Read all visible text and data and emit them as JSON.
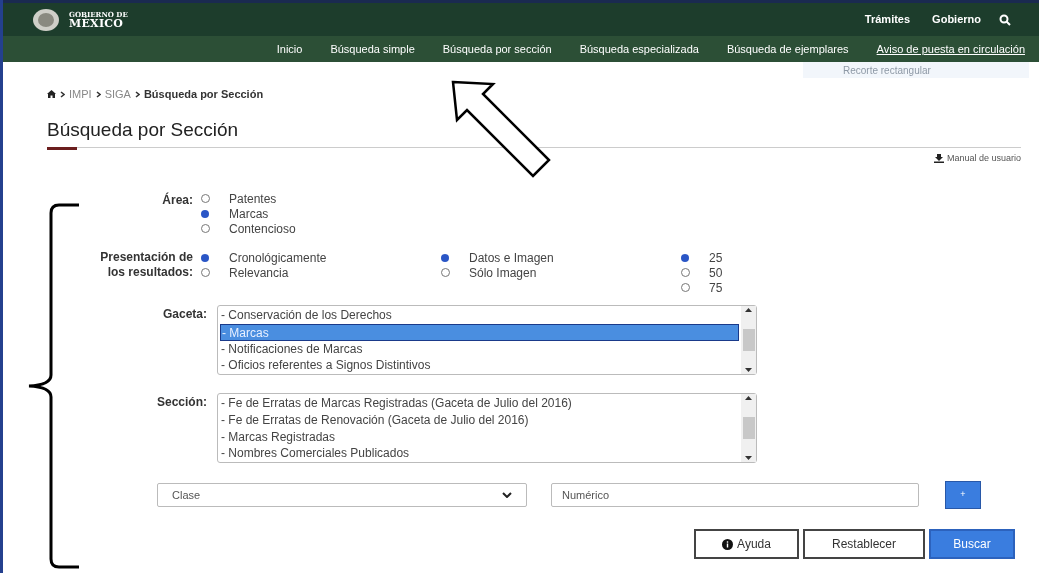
{
  "header": {
    "logo_lines": [
      "GOBIERNO DE",
      "MÉXICO"
    ],
    "links": [
      "Trámites",
      "Gobierno"
    ]
  },
  "nav": [
    {
      "label": "Inicio",
      "selected": false
    },
    {
      "label": "Búsqueda simple",
      "selected": false
    },
    {
      "label": "Búsqueda por sección",
      "selected": false
    },
    {
      "label": "Búsqueda especializada",
      "selected": false
    },
    {
      "label": "Búsqueda de ejemplares",
      "selected": false
    },
    {
      "label": "Aviso de puesta en circulación",
      "selected": true
    }
  ],
  "snip_tooltip": "Recorte rectangular",
  "breadcrumb": [
    "IMPI",
    "SIGA",
    "Búsqueda por Sección"
  ],
  "title": "Búsqueda por Sección",
  "manual_link": "Manual de usuario",
  "area": {
    "label": "Área:",
    "options": [
      {
        "label": "Patentes",
        "selected": false
      },
      {
        "label": "Marcas",
        "selected": true
      },
      {
        "label": "Contencioso",
        "selected": false
      }
    ]
  },
  "presentation": {
    "label": "Presentación de los resultados:",
    "groups": [
      [
        {
          "label": "Cronológicamente",
          "selected": true
        },
        {
          "label": "Relevancia",
          "selected": false
        }
      ],
      [
        {
          "label": "Datos e Imagen",
          "selected": true
        },
        {
          "label": "Sólo Imagen",
          "selected": false
        }
      ],
      [
        {
          "label": "25",
          "selected": true
        },
        {
          "label": "50",
          "selected": false
        },
        {
          "label": "75",
          "selected": false
        }
      ]
    ]
  },
  "gaceta": {
    "label": "Gaceta:",
    "items": [
      {
        "label": "- Conservación de los Derechos",
        "selected": false
      },
      {
        "label": "- Marcas",
        "selected": true
      },
      {
        "label": "- Notificaciones de Marcas",
        "selected": false
      },
      {
        "label": "- Oficios referentes a Signos Distintivos",
        "selected": false
      }
    ]
  },
  "seccion": {
    "label": "Sección:",
    "items": [
      {
        "label": "- Fe de Erratas de Marcas Registradas (Gaceta de Julio del 2016)",
        "selected": false
      },
      {
        "label": "- Fe de Erratas de Renovación (Gaceta de Julio del 2016)",
        "selected": false
      },
      {
        "label": "- Marcas Registradas",
        "selected": false
      },
      {
        "label": "- Nombres Comerciales Publicados",
        "selected": false
      }
    ]
  },
  "clase": {
    "placeholder": "Clase"
  },
  "numerico": {
    "placeholder": "Numérico"
  },
  "add_button": "+",
  "buttons": [
    {
      "label": "Ayuda",
      "kind": "help"
    },
    {
      "label": "Restablecer",
      "kind": "default"
    },
    {
      "label": "Buscar",
      "kind": "primary"
    }
  ]
}
